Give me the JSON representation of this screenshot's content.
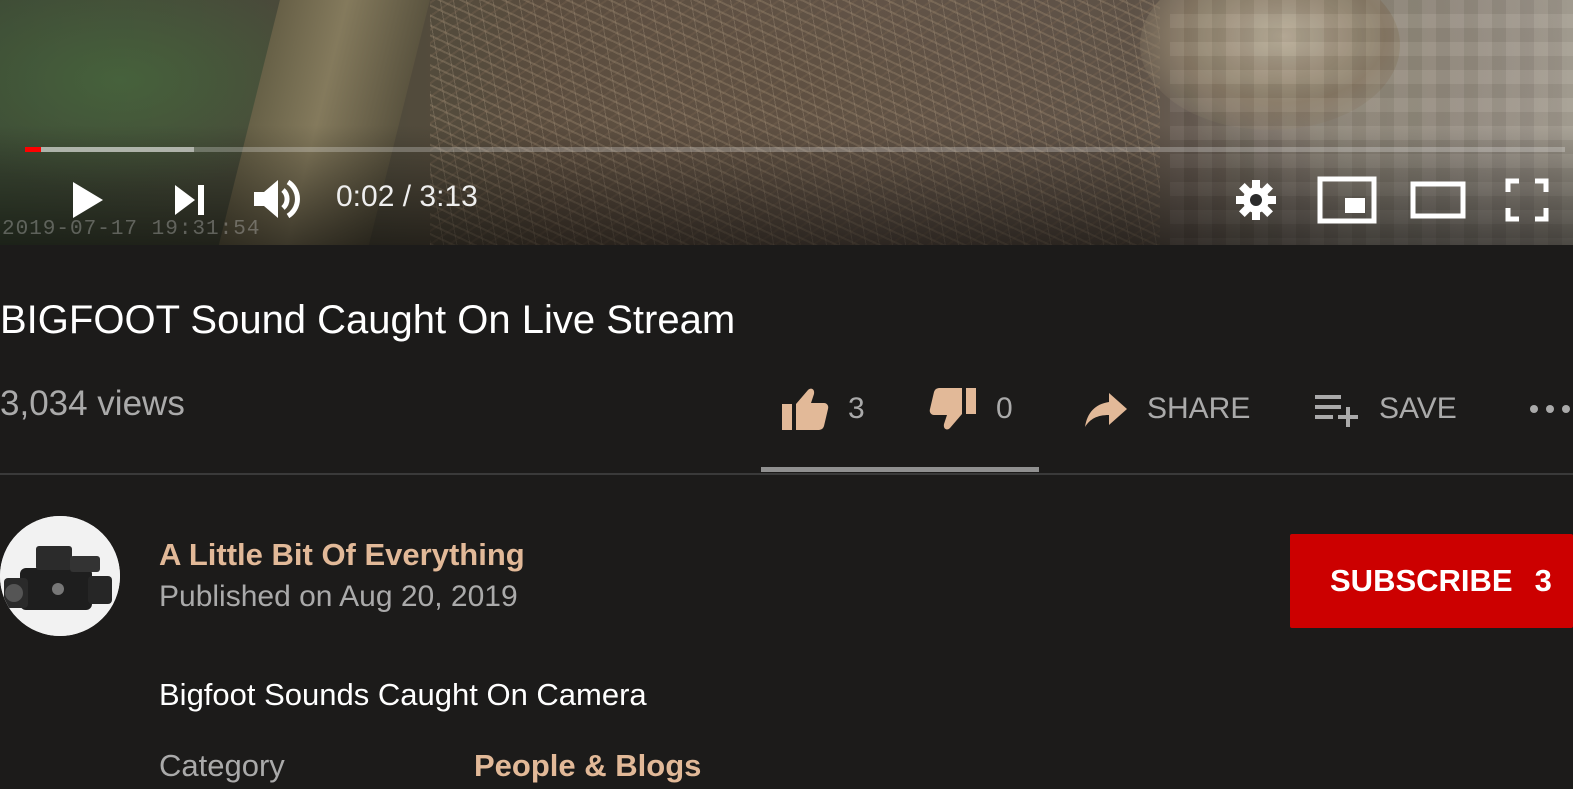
{
  "video": {
    "camera_timestamp": "2019-07-17 19:31:54",
    "progress": {
      "played_fraction": 0.0107,
      "buffered_fraction": 0.11,
      "played_color": "#ff0000"
    },
    "controls": {
      "play_icon": "play-icon",
      "next_icon": "next-icon",
      "volume_icon": "volume-icon",
      "settings_icon": "gear-icon",
      "miniplayer_icon": "miniplayer-icon",
      "theater_icon": "theater-mode-icon",
      "fullscreen_icon": "fullscreen-icon"
    },
    "time_display": "0:02 / 3:13"
  },
  "info": {
    "title": "BIGFOOT Sound Caught On Live Stream",
    "views": "3,034 views",
    "actions": {
      "like_count": "3",
      "dislike_count": "0",
      "share_label": "SHARE",
      "save_label": "SAVE",
      "like_icon": "thumbs-up-icon",
      "dislike_icon": "thumbs-down-icon",
      "share_icon": "share-arrow-icon",
      "save_icon": "playlist-add-icon",
      "more_icon": "more-horizontal-icon"
    },
    "like_ratio": 1.0
  },
  "channel": {
    "name": "A Little Bit Of Everything",
    "published": "Published on Aug 20, 2019",
    "subscribe_label": "SUBSCRIBE",
    "subscriber_count": "3",
    "accent_color": "#e2b998",
    "subscribe_color": "#cc0000"
  },
  "description": {
    "text": "Bigfoot Sounds Caught On Camera",
    "category_label": "Category",
    "category_value": "People & Blogs"
  }
}
